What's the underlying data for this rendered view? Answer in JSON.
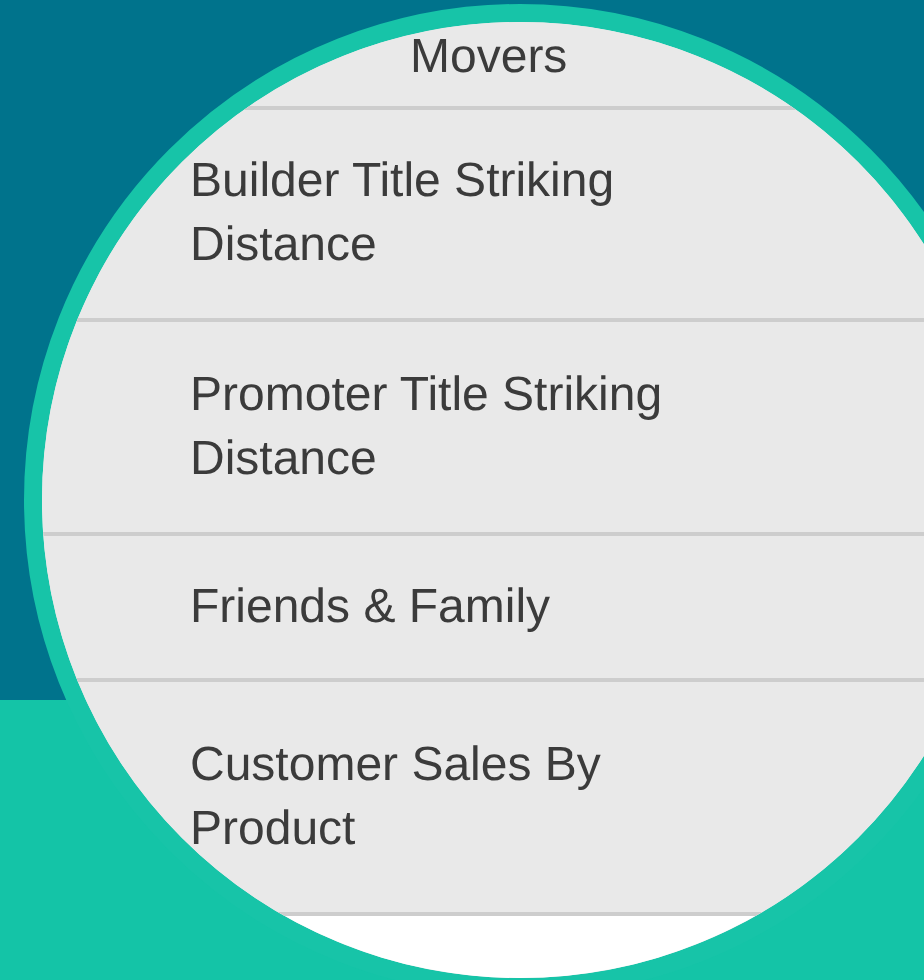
{
  "menu": {
    "items": [
      {
        "label": "Movers",
        "kind": "cut"
      },
      {
        "label": "Builder Title Striking Distance",
        "kind": "full"
      },
      {
        "label": "Promoter Title Striking Distance",
        "kind": "full"
      },
      {
        "label": "Friends & Family",
        "kind": "full"
      },
      {
        "label": "Customer Sales By Product",
        "kind": "full"
      }
    ]
  }
}
